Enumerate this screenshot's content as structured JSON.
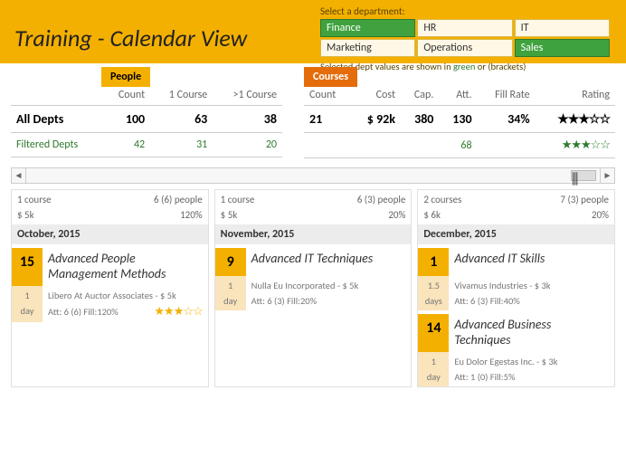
{
  "header": {
    "title": "Training - Calendar View",
    "select_label": "Select a department:",
    "departments": [
      "Finance",
      "HR",
      "IT",
      "Marketing",
      "Operations",
      "Sales"
    ],
    "active": [
      "Finance",
      "Sales"
    ],
    "note_pre": "Selected dept values are shown in ",
    "note_green": "green",
    "note_post": " or (brackets)"
  },
  "panels": {
    "people": {
      "label": "People",
      "headers": [
        "",
        "Count",
        "1 Course",
        ">1 Course"
      ],
      "all_label": "All Depts",
      "all": [
        "100",
        "63",
        "38"
      ],
      "filt_label": "Filtered Depts",
      "filt": [
        "42",
        "31",
        "20"
      ]
    },
    "courses": {
      "label": "Courses",
      "headers": [
        "Count",
        "Cost",
        "Cap.",
        "Att.",
        "Fill Rate",
        "Rating"
      ],
      "all": [
        "21",
        "$ 92k",
        "380",
        "130",
        "34%",
        "★★★☆☆"
      ],
      "filt": [
        "",
        "",
        "",
        "68",
        "",
        "★★★☆☆"
      ]
    }
  },
  "months": [
    {
      "summary_courses": "1 course",
      "summary_people": "6 (6) people",
      "summary_cost": "$ 5k",
      "summary_fill": "120%",
      "label": "October, 2015",
      "courses": [
        {
          "date": "15",
          "title": "Advanced People Management Methods",
          "dur1": "1",
          "dur2": "day",
          "vendor": "Libero At Auctor Associates - $ 5k",
          "att": "Att: 6 (6) Fill:120%",
          "stars": "★★★☆☆"
        }
      ]
    },
    {
      "summary_courses": "1 course",
      "summary_people": "6 (3) people",
      "summary_cost": "$ 5k",
      "summary_fill": "20%",
      "label": "November, 2015",
      "courses": [
        {
          "date": "9",
          "title": "Advanced IT Techniques",
          "dur1": "1",
          "dur2": "day",
          "vendor": "Nulla Eu Incorporated - $ 5k",
          "att": "Att: 6 (3) Fill:20%",
          "stars": ""
        }
      ]
    },
    {
      "summary_courses": "2 courses",
      "summary_people": "7 (3) people",
      "summary_cost": "$ 6k",
      "summary_fill": "20%",
      "label": "December, 2015",
      "courses": [
        {
          "date": "1",
          "title": "Advanced IT Skills",
          "dur1": "1.5",
          "dur2": "days",
          "vendor": "Vivamus Industries - $ 3k",
          "att": "Att: 6 (3) Fill:40%",
          "stars": ""
        },
        {
          "date": "14",
          "title": "Advanced Business Techniques",
          "dur1": "1",
          "dur2": "day",
          "vendor": "Eu Dolor Egestas Inc. - $ 3k",
          "att": "Att: 1 (0) Fill:5%",
          "stars": ""
        }
      ]
    }
  ]
}
